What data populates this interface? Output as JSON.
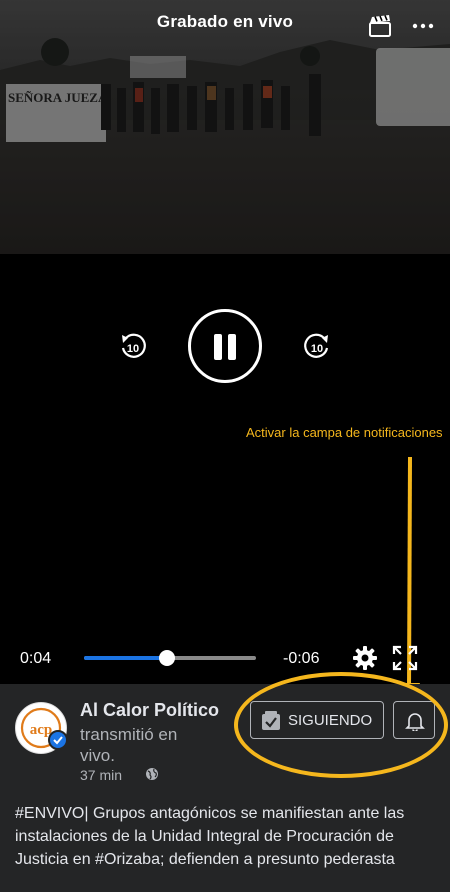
{
  "video": {
    "title": "Grabado en vivo",
    "progress_fraction": 0.48,
    "elapsed": "0:04",
    "remaining": "-0:06",
    "rewind_seconds": "10",
    "forward_seconds": "10",
    "banner_text": "SEÑORA JUEZA!"
  },
  "annotation": {
    "text": "Activar la campa de notificaciones",
    "color": "#f5b71d"
  },
  "post": {
    "page_name": "Al Calor Político",
    "action": "transmitió en vivo.",
    "time": "37 min",
    "follow_label": "SIGUIENDO",
    "caption": "#ENVIVO| Grupos antagónicos se manifiestan ante las instalaciones de la Unidad Integral de Procuración de Justicia en #Orizaba; defienden a presunto pederasta",
    "avatar_text": "acp"
  },
  "colors": {
    "accent": "#1b74e4",
    "panel": "#242526",
    "text_secondary": "#b0b3b8",
    "logo_orange": "#e07b1a"
  },
  "icons": [
    "clapperboard-icon",
    "more-dots-icon",
    "rewind-10-icon",
    "pause-icon",
    "forward-10-icon",
    "settings-gear-icon",
    "fullscreen-icon",
    "verified-badge-icon",
    "globe-icon",
    "following-check-icon",
    "bell-icon"
  ]
}
